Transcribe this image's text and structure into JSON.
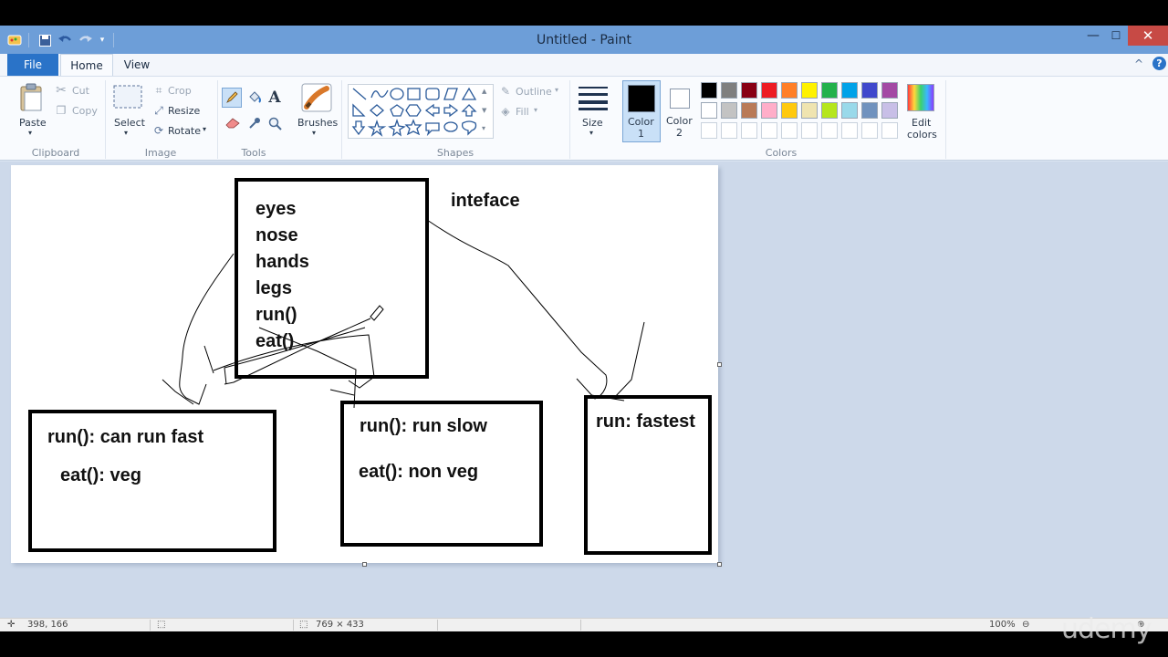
{
  "window": {
    "title": "Untitled - Paint"
  },
  "titlebar": {
    "quick_access_icons": [
      "paint-app-icon",
      "save-icon",
      "undo-icon",
      "redo-icon",
      "customize-dropdown-icon"
    ],
    "minimize_glyph": "—",
    "maximize_glyph": "☐",
    "close_glyph": "✕"
  },
  "tabs": {
    "file": "File",
    "home": "Home",
    "view": "View",
    "help_glyph": "?",
    "collapse_glyph": "^"
  },
  "ribbon": {
    "clipboard": {
      "group": "Clipboard",
      "paste": "Paste",
      "cut": "Cut",
      "copy": "Copy"
    },
    "image": {
      "group": "Image",
      "select": "Select",
      "crop": "Crop",
      "resize": "Resize",
      "rotate": "Rotate"
    },
    "tools": {
      "group": "Tools"
    },
    "brushes": {
      "label": "Brushes"
    },
    "shapes": {
      "group": "Shapes",
      "outline": "Outline",
      "fill": "Fill"
    },
    "size": {
      "label": "Size"
    },
    "color1": {
      "label": "Color",
      "num": "1",
      "value": "#000000"
    },
    "color2": {
      "label": "Color",
      "num": "2",
      "value": "#ffffff"
    },
    "colors": {
      "group": "Colors",
      "edit": "Edit",
      "edit2": "colors",
      "row1": [
        "#000000",
        "#7f7f7f",
        "#880015",
        "#ed1c24",
        "#ff7f27",
        "#fff200",
        "#22b14c",
        "#00a2e8",
        "#3f48cc",
        "#a349a4"
      ],
      "row2": [
        "#ffffff",
        "#c3c3c3",
        "#b97a57",
        "#ffaec9",
        "#ffc90e",
        "#efe4b0",
        "#b5e61d",
        "#99d9ea",
        "#7092be",
        "#c8bfe7"
      ]
    }
  },
  "canvas": {
    "interface_label": "inteface",
    "top_box": [
      "eyes",
      "nose",
      "hands",
      "legs",
      "run()",
      "eat()"
    ],
    "left_box": {
      "line1": "run(): can run fast",
      "line2": "eat(): veg"
    },
    "middle_box": {
      "line1": "run(): run slow",
      "line2": "eat(): non veg"
    },
    "right_box": {
      "line1": "run: fastest"
    }
  },
  "status": {
    "cursor_pos": "398, 166",
    "canvas_size": "769 × 433",
    "zoom": "100%"
  },
  "watermark": "udemy"
}
